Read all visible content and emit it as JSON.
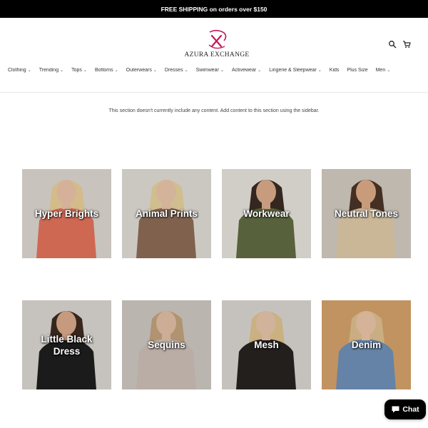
{
  "announcement": {
    "text": "FREE SHIPPING on orders over $150"
  },
  "brand": {
    "name": "AZURA EXCHANGE",
    "accent_color": "#c2185b"
  },
  "header": {
    "search_icon": "search-icon",
    "cart_icon": "cart-icon"
  },
  "nav": {
    "items": [
      {
        "label": "Clothing",
        "dropdown": true
      },
      {
        "label": "Trending",
        "dropdown": true
      },
      {
        "label": "Tops",
        "dropdown": true
      },
      {
        "label": "Bottoms",
        "dropdown": true
      },
      {
        "label": "Outerwears",
        "dropdown": true
      },
      {
        "label": "Dresses",
        "dropdown": true
      },
      {
        "label": "Swimwear",
        "dropdown": true
      },
      {
        "label": "Activewear",
        "dropdown": true
      },
      {
        "label": "Lingerie & Sleepwear",
        "dropdown": true
      },
      {
        "label": "Kids",
        "dropdown": false
      },
      {
        "label": "Plus Size",
        "dropdown": false
      },
      {
        "label": "Men",
        "dropdown": true
      }
    ]
  },
  "main": {
    "empty_message": "This section doesn't currently include any content. Add content to this section using the sidebar."
  },
  "collections": [
    {
      "label": "Hyper Brights",
      "bg": "#d9d4ce",
      "garment": "#e0715b",
      "skin": "#e9c1a6",
      "hair": "#e6cc96"
    },
    {
      "label": "Animal Prints",
      "bg": "#ddd9d2",
      "garment": "#8a6a55",
      "skin": "#e5c3a7",
      "hair": "#e3cf9c"
    },
    {
      "label": "Workwear",
      "bg": "#e3e0da",
      "garment": "#5f6a40",
      "skin": "#d8aa89",
      "hair": "#3a2b22"
    },
    {
      "label": "Neutral Tones",
      "bg": "#cfc8bd",
      "garment": "#dcc7a5",
      "skin": "#d9aa86",
      "hair": "#4a3326"
    },
    {
      "label": "Little Black Dress",
      "bg": "#d7d3ce",
      "garment": "#1e1e1e",
      "skin": "#d6a889",
      "hair": "#3c2a20"
    },
    {
      "label": "Sequins",
      "bg": "#cbc5bf",
      "garment": "#c9bcb3",
      "skin": "#dfbca2",
      "hair": "#bfa07a"
    },
    {
      "label": "Mesh",
      "bg": "#d6d3cf",
      "garment": "#262220",
      "skin": "#e3c2a8",
      "hair": "#dcc08c"
    },
    {
      "label": "Denim",
      "bg": "#d2a06a",
      "garment": "#6d8fb5",
      "skin": "#e6c3a5",
      "hair": "#dcbd8c"
    }
  ],
  "chat": {
    "label": "Chat"
  }
}
